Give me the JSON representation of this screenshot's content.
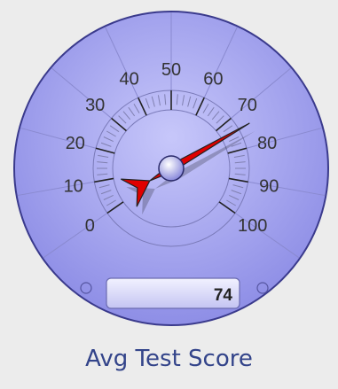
{
  "chart_data": {
    "type": "gauge",
    "title": "Avg Test Score",
    "value": 74,
    "min": 0,
    "max": 100,
    "ticks": [
      0,
      10,
      20,
      30,
      40,
      50,
      60,
      70,
      80,
      90,
      100
    ],
    "tick_labels": [
      "0",
      "10",
      "20",
      "30",
      "40",
      "50",
      "60",
      "70",
      "80",
      "90",
      "100"
    ],
    "readout": "74"
  },
  "colors": {
    "dial_face": "#a9a9f4",
    "dial_rim": "#3a3a8c",
    "needle": "#e00000",
    "title": "#33448a",
    "background": "#ececec"
  }
}
